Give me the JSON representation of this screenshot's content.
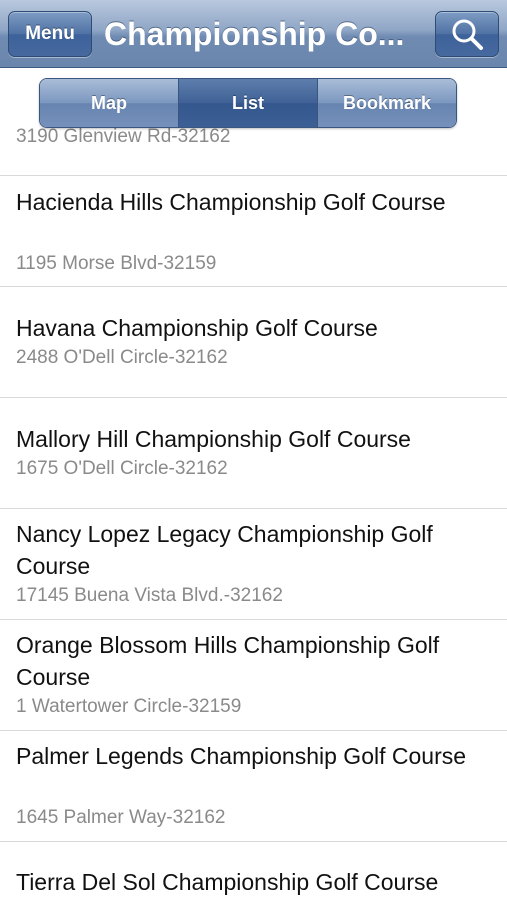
{
  "navbar": {
    "menu_label": "Menu",
    "title": "Championship Co...",
    "search_icon": "search-icon"
  },
  "tabs": [
    {
      "label": "Map",
      "selected": false
    },
    {
      "label": "List",
      "selected": true
    },
    {
      "label": "Bookmark",
      "selected": false
    }
  ],
  "courses": [
    {
      "name": "",
      "address": "3190 Glenview Rd-32162"
    },
    {
      "name": "Hacienda Hills Championship Golf Course",
      "address": "1195 Morse Blvd-32159"
    },
    {
      "name": "Havana Championship Golf Course",
      "address": "2488 O'Dell Circle-32162"
    },
    {
      "name": "Mallory Hill Championship Golf Course",
      "address": "1675 O'Dell Circle-32162"
    },
    {
      "name": "Nancy Lopez Legacy Championship Golf Course",
      "address": "17145 Buena Vista Blvd.-32162"
    },
    {
      "name": "Orange Blossom Hills Championship Golf Course",
      "address": "1 Watertower Circle-32159"
    },
    {
      "name": "Palmer Legends Championship Golf Course",
      "address": "1645 Palmer Way-32162"
    },
    {
      "name": "Tierra Del Sol Championship Golf Course",
      "address": ""
    }
  ]
}
